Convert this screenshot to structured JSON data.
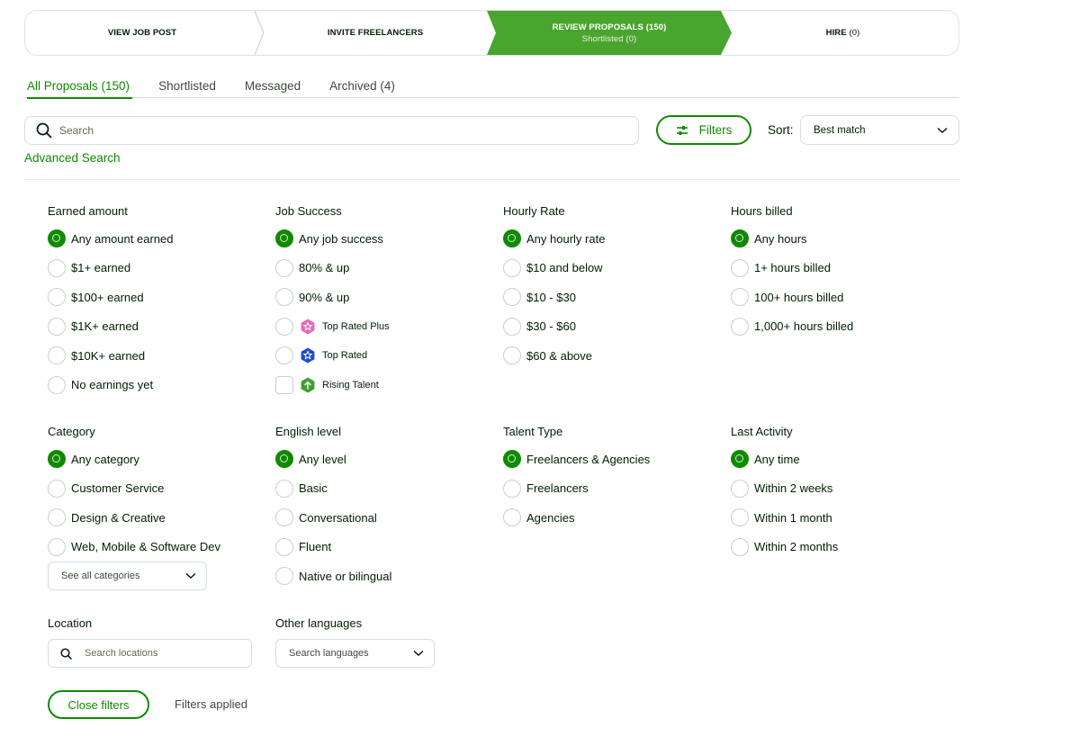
{
  "colors": {
    "brand_green": "#108a00",
    "active_step_green": "#4aa52e",
    "border": "#d5e0d5",
    "text": "#001e00"
  },
  "stepper": {
    "steps": [
      {
        "label": "VIEW JOB POST",
        "count": "",
        "sub": "",
        "active": false
      },
      {
        "label": "INVITE FREELANCERS",
        "count": "",
        "sub": "",
        "active": false
      },
      {
        "label": "REVIEW PROPOSALS",
        "count": "(150)",
        "sub": "Shortlisted (0)",
        "active": true
      },
      {
        "label": "HIRE",
        "count": "(0)",
        "sub": "",
        "active": false
      }
    ]
  },
  "tabs": [
    {
      "label": "All Proposals (150)",
      "active": true
    },
    {
      "label": "Shortlisted",
      "active": false
    },
    {
      "label": "Messaged",
      "active": false
    },
    {
      "label": "Archived (4)",
      "active": false
    }
  ],
  "search": {
    "placeholder": "Search",
    "value": "",
    "icon": "search-icon"
  },
  "filters_button": {
    "label": "Filters",
    "icon": "sliders-icon"
  },
  "sort": {
    "label": "Sort:",
    "selected": "Best match",
    "icon": "chevron-down-icon"
  },
  "advanced_search": "Advanced Search",
  "filter_groups": {
    "earned": {
      "title": "Earned amount",
      "options": [
        "Any amount earned",
        "$1+ earned",
        "$100+ earned",
        "$1K+ earned",
        "$10K+ earned",
        "No earnings yet"
      ],
      "selected": 0
    },
    "job_success": {
      "title": "Job Success",
      "options": [
        "Any job success",
        "80% & up",
        "90% & up"
      ],
      "badges": [
        {
          "label": "Top Rated Plus",
          "icon": "top-rated-plus-badge-icon",
          "color": "#e46ab3",
          "control": "radio"
        },
        {
          "label": "Top Rated",
          "icon": "top-rated-badge-icon",
          "color": "#1c4fc6",
          "control": "radio"
        },
        {
          "label": "Rising Talent",
          "icon": "rising-talent-badge-icon",
          "color": "#3da12c",
          "control": "checkbox"
        }
      ],
      "selected": 0
    },
    "hourly": {
      "title": "Hourly Rate",
      "options": [
        "Any hourly rate",
        "$10 and below",
        "$10 - $30",
        "$30 - $60",
        "$60 & above"
      ],
      "selected": 0
    },
    "hours": {
      "title": "Hours billed",
      "options": [
        "Any hours",
        "1+ hours billed",
        "100+ hours billed",
        "1,000+ hours billed"
      ],
      "selected": 0
    },
    "category": {
      "title": "Category",
      "options": [
        "Any category",
        "Customer Service",
        "Design & Creative",
        "Web, Mobile & Software Dev"
      ],
      "selected": 0,
      "see_all": "See all categories"
    },
    "english": {
      "title": "English level",
      "options": [
        "Any level",
        "Basic",
        "Conversational",
        "Fluent",
        "Native or bilingual"
      ],
      "selected": 0
    },
    "talent": {
      "title": "Talent Type",
      "options": [
        "Freelancers & Agencies",
        "Freelancers",
        "Agencies"
      ],
      "selected": 0
    },
    "activity": {
      "title": "Last Activity",
      "options": [
        "Any time",
        "Within 2 weeks",
        "Within 1 month",
        "Within 2 months"
      ],
      "selected": 0
    },
    "location": {
      "title": "Location",
      "placeholder": "Search locations",
      "value": ""
    },
    "languages": {
      "title": "Other languages",
      "placeholder": "Search languages"
    }
  },
  "footer": {
    "close_label": "Close filters",
    "status": "Filters applied"
  }
}
